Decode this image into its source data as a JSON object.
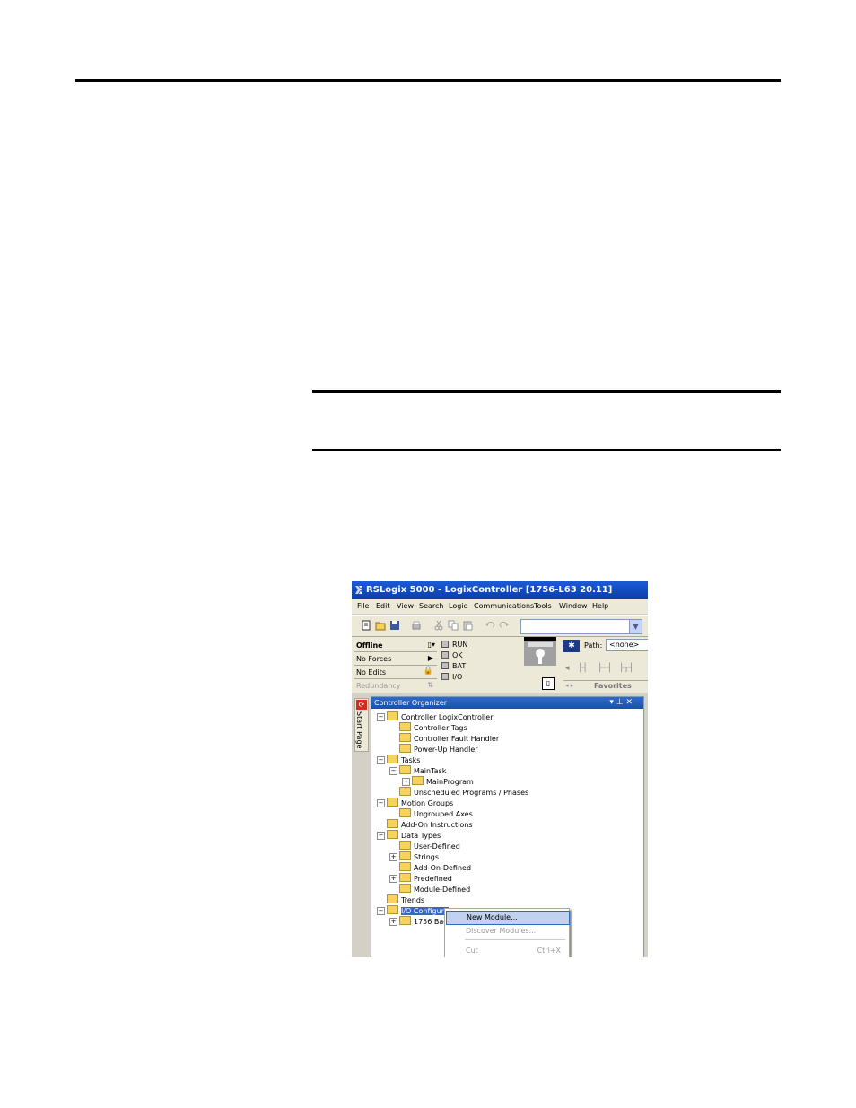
{
  "window": {
    "title": "RSLogix 5000 - LogixController [1756-L63 20.11]"
  },
  "menu": [
    "File",
    "Edit",
    "View",
    "Search",
    "Logic",
    "Communications",
    "Tools",
    "Window",
    "Help"
  ],
  "status": {
    "mode": "Offline",
    "forces": "No Forces",
    "edits": "No Edits",
    "redundancy": "Redundancy",
    "indicators": [
      "RUN",
      "OK",
      "BAT",
      "I/O"
    ]
  },
  "path": {
    "label": "Path:",
    "value": "<none>"
  },
  "favorites_tab": "Favorites",
  "side_tab": "Start Page",
  "organizer": {
    "title": "Controller Organizer",
    "tree": [
      {
        "label": "Controller LogixController",
        "level": 0,
        "toggle": "⊟"
      },
      {
        "label": "Controller Tags",
        "level": 1,
        "toggle": ""
      },
      {
        "label": "Controller Fault Handler",
        "level": 1,
        "toggle": ""
      },
      {
        "label": "Power-Up Handler",
        "level": 1,
        "toggle": ""
      },
      {
        "label": "Tasks",
        "level": 0,
        "toggle": "⊟"
      },
      {
        "label": "MainTask",
        "level": 1,
        "toggle": "⊟"
      },
      {
        "label": "MainProgram",
        "level": 2,
        "toggle": "⊞"
      },
      {
        "label": "Unscheduled Programs / Phases",
        "level": 1,
        "toggle": ""
      },
      {
        "label": "Motion Groups",
        "level": 0,
        "toggle": "⊟"
      },
      {
        "label": "Ungrouped Axes",
        "level": 1,
        "toggle": ""
      },
      {
        "label": "Add-On Instructions",
        "level": 0,
        "toggle": ""
      },
      {
        "label": "Data Types",
        "level": 0,
        "toggle": "⊟"
      },
      {
        "label": "User-Defined",
        "level": 1,
        "toggle": ""
      },
      {
        "label": "Strings",
        "level": 1,
        "toggle": "⊞"
      },
      {
        "label": "Add-On-Defined",
        "level": 1,
        "toggle": ""
      },
      {
        "label": "Predefined",
        "level": 1,
        "toggle": "⊞"
      },
      {
        "label": "Module-Defined",
        "level": 1,
        "toggle": ""
      },
      {
        "label": "Trends",
        "level": 0,
        "toggle": ""
      },
      {
        "label": "I/O Configura",
        "level": 0,
        "toggle": "⊟"
      },
      {
        "label": "1756 Bac",
        "level": 1,
        "toggle": "⊞"
      }
    ]
  },
  "context_menu": [
    {
      "label": "New Module...",
      "shortcut": ""
    },
    {
      "label": "Discover Modules...",
      "shortcut": ""
    },
    {
      "label": "Cut",
      "shortcut": "Ctrl+X"
    }
  ]
}
